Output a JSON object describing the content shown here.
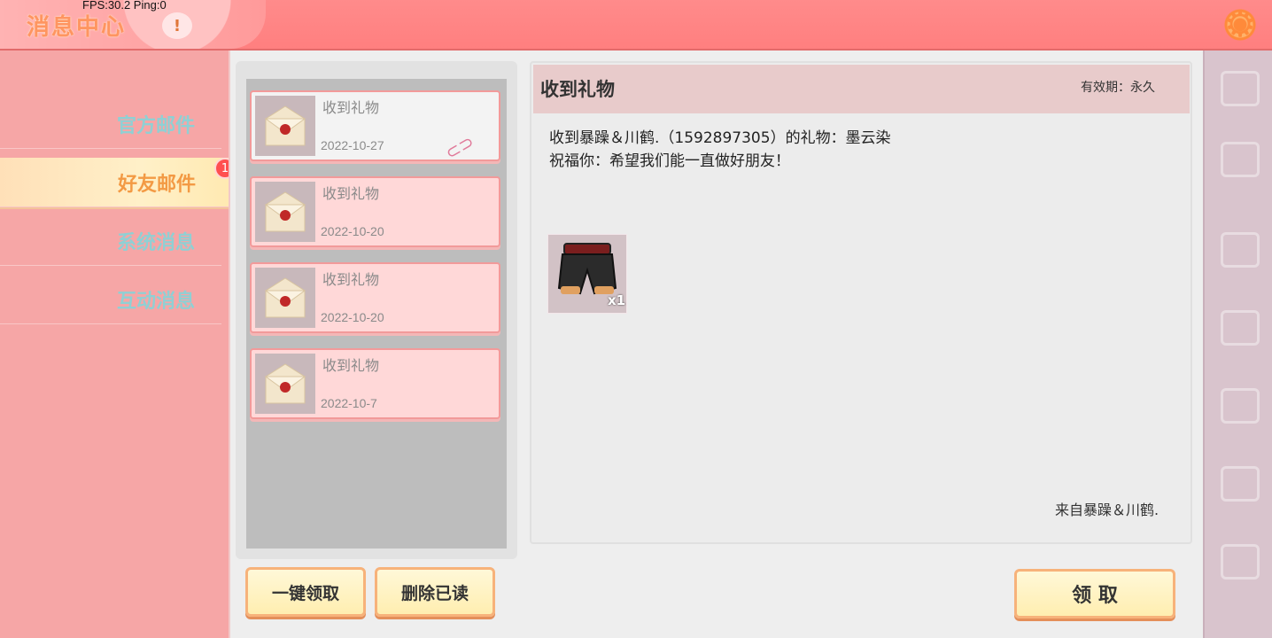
{
  "header": {
    "title": "消息中心",
    "fps_text": "FPS:30.2  Ping:0",
    "alert_symbol": "!",
    "settings_icon": "gear-icon",
    "accent": "#ff8b8b"
  },
  "sidebar": {
    "tabs": [
      {
        "label": "官方邮件",
        "active": false
      },
      {
        "label": "好友邮件",
        "active": true,
        "badge": "1"
      },
      {
        "label": "系统消息",
        "active": false
      },
      {
        "label": "互动消息",
        "active": false
      }
    ]
  },
  "mail_list": {
    "items": [
      {
        "title": "收到礼物",
        "date": "2022-10-27",
        "selected": true,
        "has_attachment": true
      },
      {
        "title": "收到礼物",
        "date": "2022-10-20",
        "selected": false,
        "has_attachment": false
      },
      {
        "title": "收到礼物",
        "date": "2022-10-20",
        "selected": false,
        "has_attachment": false
      },
      {
        "title": "收到礼物",
        "date": "2022-10-7",
        "selected": false,
        "has_attachment": false
      }
    ],
    "claim_all_label": "一键领取",
    "delete_read_label": "删除已读"
  },
  "detail": {
    "title": "收到礼物",
    "validity": "有效期：永久",
    "body_line1": "收到暴躁＆川鹤.（1592897305）的礼物：墨云染",
    "body_line2": "祝福你：希望我们能一直做好朋友！",
    "gift_count": "x1",
    "sender": "来自暴躁＆川鹤.",
    "claim_label": "领 取"
  }
}
